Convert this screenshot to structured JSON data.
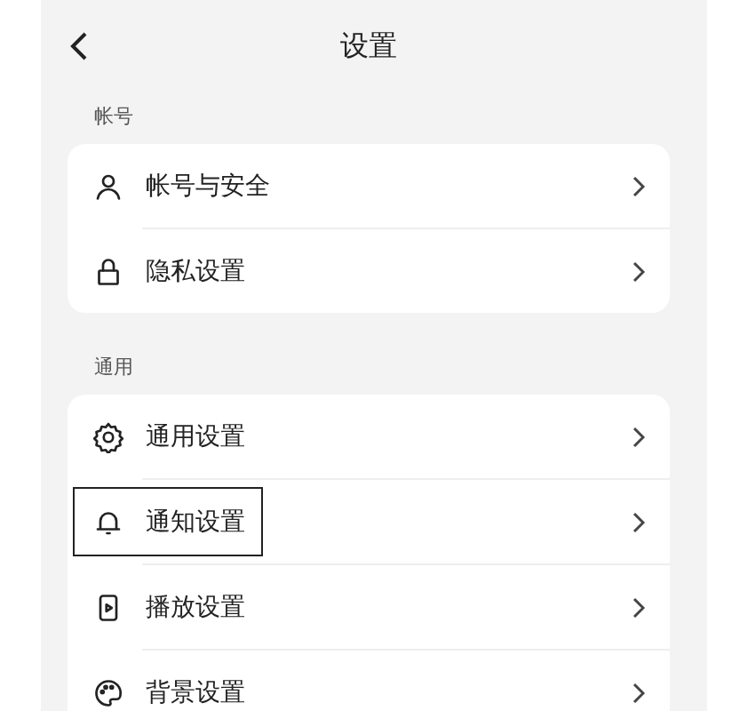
{
  "nav": {
    "title": "设置"
  },
  "sections": [
    {
      "title": "帐号",
      "items": [
        {
          "label": "帐号与安全",
          "kind": "person",
          "highlighted": false
        },
        {
          "label": "隐私设置",
          "kind": "lock",
          "highlighted": false
        }
      ]
    },
    {
      "title": "通用",
      "items": [
        {
          "label": "通用设置",
          "kind": "gear",
          "highlighted": false
        },
        {
          "label": "通知设置",
          "kind": "bell",
          "highlighted": true
        },
        {
          "label": "播放设置",
          "kind": "play",
          "highlighted": false
        },
        {
          "label": "背景设置",
          "kind": "palette",
          "highlighted": false
        }
      ]
    }
  ]
}
